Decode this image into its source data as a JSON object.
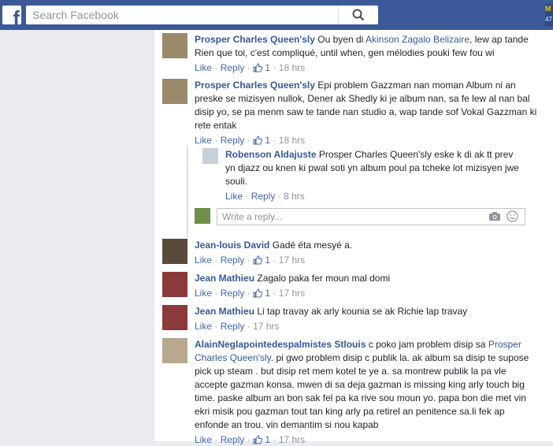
{
  "search": {
    "placeholder": "Search Facebook"
  },
  "badge": {
    "line1": "M",
    "line2": "47"
  },
  "actions": {
    "like": "Like",
    "reply": "Reply",
    "sep": "·"
  },
  "write_reply": {
    "placeholder": "Write a reply..."
  },
  "comments": [
    {
      "name": "Prosper Charles Queen'sly",
      "pre": "Ou byen di",
      "mention": "Akinson Zagalo Belizaire",
      "text": ", lew ap tande Rien que toi, c'est compliqué, until when, gen mélodies pouki few fou wi",
      "likes": "1",
      "time": "18 hrs"
    },
    {
      "name": "Prosper Charles Queen'sly",
      "text": "Epi problem Gazzman nan moman Album ni an preske se mizisyen nullok, Dener ak Shedly ki je album nan, sa fe lew al nan bal disip yo, se pa menm saw te tande nan studio a, wap tande sof Vokal Gazzman ki rete entak",
      "likes": "1",
      "time": "18 hrs"
    },
    {
      "name": "Robenson Aldajuste",
      "text": "Prosper Charles Queen'sly eske k di ak tt prev yn djazz ou knen ki pwal soti yn album poul pa tcheke lot mizisyen jwe souli.",
      "time": "8 hrs"
    },
    {
      "name": "Jean-louis David",
      "text": "Gadé éta mesyé a.",
      "likes": "1",
      "time": "17 hrs"
    },
    {
      "name": "Jean Mathieu",
      "text": "Zagalo paka fer moun mal domi",
      "likes": "1",
      "time": "17 hrs"
    },
    {
      "name": "Jean Mathieu",
      "text": "Li tap travay ak arly kounia se ak Richie lap travay",
      "time": "17 hrs"
    },
    {
      "name": "AlainNeglapointedespalmistes Stlouis",
      "pre": "c poko jam problem disip sa",
      "mention": "Prosper Charles Queen'sly",
      "text": ". pi gwo problem disip c publik la. ak album sa disip te supose pick up steam . but disip ret mem kotel te ye a. sa montrew publik la pa vle accepte gazman konsa. mwen di sa deja gazman is missing king arly touch big time. paske album an bon sak fel pa ka rive sou moun yo. papa bon die met vin ekri misik pou gazman tout tan king arly pa retirel an penitence sa.li fek ap enfonde an trou. vin demantim si nou kapab",
      "likes": "1",
      "time": "17 hrs"
    }
  ]
}
